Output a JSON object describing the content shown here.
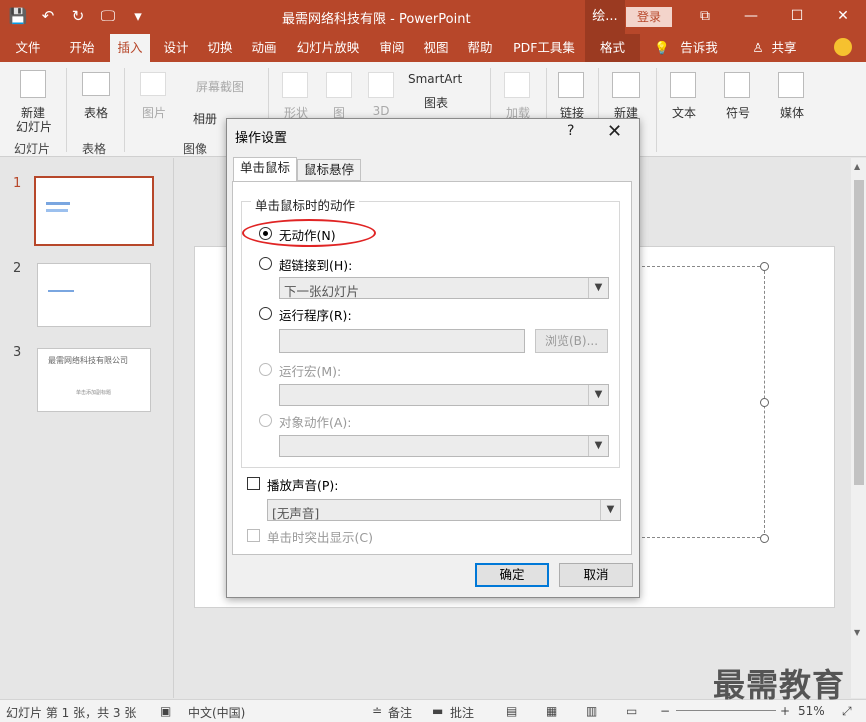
{
  "window": {
    "title": "最需网络科技有限 - PowerPoint",
    "context_tab": "绘...",
    "login": "登录",
    "controls": {
      "options": "⧉",
      "minimize": "—",
      "maximize": "☐",
      "close": "✕"
    }
  },
  "quick_access": {
    "save": "💾",
    "undo": "↶",
    "redo": "↻",
    "present": "🖵",
    "more": "▾"
  },
  "ribbon_tabs": [
    "文件",
    "开始",
    "插入",
    "设计",
    "切换",
    "动画",
    "幻灯片放映",
    "审阅",
    "视图",
    "帮助",
    "PDF工具集",
    "格式"
  ],
  "active_tab": "插入",
  "tell_me": "告诉我",
  "share": "共享",
  "ribbon": {
    "new_slide": "新建",
    "new_slide_2": "幻灯片",
    "table": "表格",
    "picture": "图片",
    "screenshot": "屏幕截图",
    "album": "相册",
    "shapes": "形状",
    "icons": "图",
    "model3d": "3D",
    "smartart": "SmartArt",
    "chart": "图表",
    "addins": "加载",
    "link": "链接",
    "comment": "新建",
    "text": "文本",
    "symbol": "符号",
    "media": "媒体",
    "groups": {
      "slides": "幻灯片",
      "tables": "表格",
      "images": "图像"
    }
  },
  "slides": [
    {
      "number": "1"
    },
    {
      "number": "2"
    },
    {
      "number": "3",
      "thumb_title": "最需网络科技有限公司",
      "thumb_sub": "单击添加副标题"
    }
  ],
  "status": {
    "slide_info": "幻灯片 第 1 张，共 3 张",
    "language": "中文(中国)",
    "notes": "备注",
    "comments": "批注",
    "zoom": "51%"
  },
  "watermark": "最需教育",
  "dialog": {
    "title": "操作设置",
    "help": "?",
    "close": "✕",
    "tabs": [
      "单击鼠标",
      "鼠标悬停"
    ],
    "group_label": "单击鼠标时的动作",
    "opt_none": "无动作(N)",
    "opt_hyperlink": "超链接到(H):",
    "hyperlink_value": "下一张幻灯片",
    "opt_program": "运行程序(R):",
    "browse": "浏览(B)...",
    "opt_macro": "运行宏(M):",
    "opt_object": "对象动作(A):",
    "play_sound": "播放声音(P):",
    "sound_value": "[无声音]",
    "highlight": "单击时突出显示(C)",
    "ok": "确定",
    "cancel": "取消"
  }
}
